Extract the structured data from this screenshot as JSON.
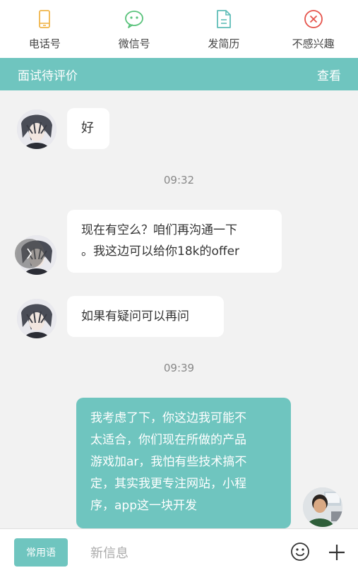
{
  "toolbar": {
    "items": [
      {
        "label": "电话号",
        "icon": "phone-icon",
        "color": "#f0b54a"
      },
      {
        "label": "微信号",
        "icon": "wechat-icon",
        "color": "#58c27a"
      },
      {
        "label": "发简历",
        "icon": "resume-icon",
        "color": "#5fbdb8"
      },
      {
        "label": "不感兴趣",
        "icon": "not-interested-icon",
        "color": "#e5534b"
      }
    ]
  },
  "banner": {
    "title": "面试待评价",
    "action": "查看",
    "color": "#6fc5bf"
  },
  "messages": {
    "m1": "好",
    "t1": "09:32",
    "m2_line1": "现在有空么？咱们再沟通一下",
    "m2_line2": "。我这边可以给你18k的offer",
    "m3": "如果有疑问可以再问",
    "t2": "09:39",
    "m4_lines": [
      "我考虑了下，你这边我可能不",
      "太适合，你们现在所做的产品",
      "游戏加ar，我怕有些技术搞不",
      "定，其实我更专注网站，小程",
      "序，app这一块开发"
    ]
  },
  "composer": {
    "phrase_button": "常用语",
    "placeholder": "新信息",
    "emoji_icon": "smiley-icon",
    "plus_icon": "plus-icon"
  },
  "accent": "#6fc5bf"
}
